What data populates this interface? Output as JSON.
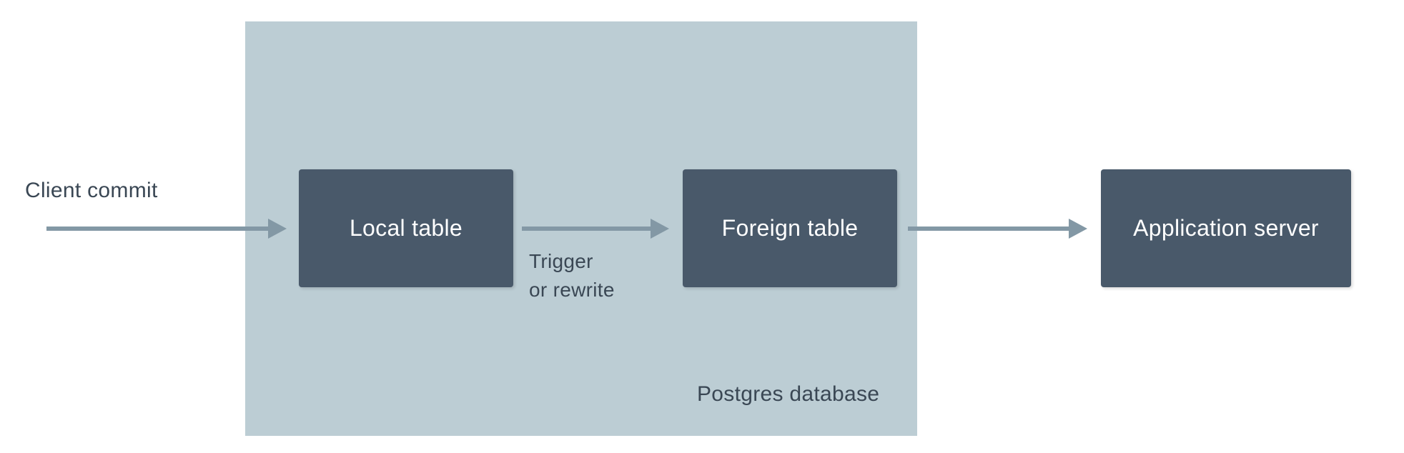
{
  "labels": {
    "client_commit": "Client commit",
    "container_title": "Postgres database",
    "edge_line1": "Trigger",
    "edge_line2": "or rewrite"
  },
  "nodes": {
    "local_table": "Local table",
    "foreign_table": "Foreign table",
    "application_server": "Application server"
  },
  "colors": {
    "container_bg": "#bccdd4",
    "node_bg": "#49596a",
    "arrow": "#8398a5",
    "text_dark": "#3a4754"
  }
}
